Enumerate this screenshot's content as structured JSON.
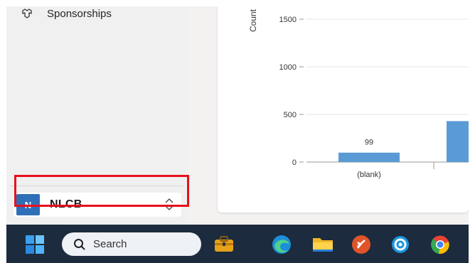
{
  "sidebar": {
    "items": [
      {
        "label": "Sponsorships",
        "icon": "sponsorships-icon"
      }
    ],
    "environment": {
      "avatar_letter": "N",
      "name": "NLCB",
      "avatar_color": "#2f6fb7"
    }
  },
  "chart_data": {
    "type": "bar",
    "ylabel": "Count",
    "ylim": [
      0,
      1600
    ],
    "yticks": [
      0,
      500,
      1000,
      1500
    ],
    "yticks_labels": [
      "0",
      "500",
      "1000",
      "1500"
    ],
    "categories": [
      "(blank)",
      ""
    ],
    "values": [
      99,
      430
    ],
    "data_labels": [
      "99",
      ""
    ],
    "bar_color": "#5b9bd5"
  },
  "taskbar": {
    "search_label": "Search",
    "apps": [
      "start-icon",
      "briefcase-icon",
      "edge-icon",
      "file-explorer-icon",
      "remote-desktop-icon",
      "cortana-icon",
      "chrome-icon"
    ]
  },
  "colors": {
    "highlight": "#e8101a",
    "taskbar": "#1c2b3d"
  }
}
